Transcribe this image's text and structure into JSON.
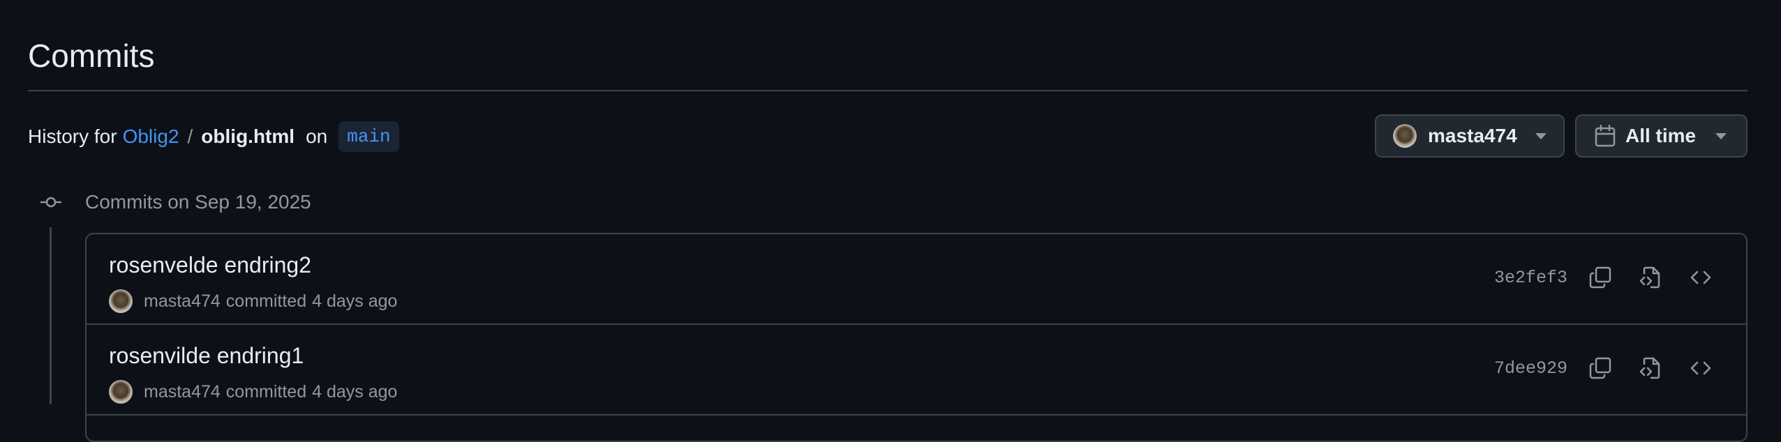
{
  "page": {
    "title": "Commits"
  },
  "history": {
    "prefix": "History for",
    "repo": "Oblig2",
    "separator": "/",
    "file": "oblig.html",
    "on": "on",
    "branch": "main"
  },
  "filters": {
    "author": {
      "label": "masta474",
      "avatar_icon": "avatar-masta474",
      "caret_icon": "triangle-down-icon"
    },
    "time": {
      "label": "All time",
      "icon": "calendar-icon",
      "caret_icon": "triangle-down-icon"
    }
  },
  "commit_groups": [
    {
      "label": "Commits on Sep 19, 2025",
      "commits": [
        {
          "message": "rosenvelde endring2",
          "author": "masta474",
          "verb": "committed",
          "time": "4 days ago",
          "sha": "3e2fef3"
        },
        {
          "message": "rosenvilde endring1",
          "author": "masta474",
          "verb": "committed",
          "time": "4 days ago",
          "sha": "7dee929"
        }
      ]
    }
  ],
  "icons": {
    "copy": "copy-icon",
    "view_file": "file-code-icon",
    "browse": "code-icon",
    "commit_node": "git-commit-icon"
  },
  "colors": {
    "background": "#0d1117",
    "text": "#e6edf3",
    "muted": "#9198a1",
    "link": "#4493f8",
    "border": "#3d444d",
    "button_bg": "#212830",
    "branch_bg": "#1b2434"
  }
}
